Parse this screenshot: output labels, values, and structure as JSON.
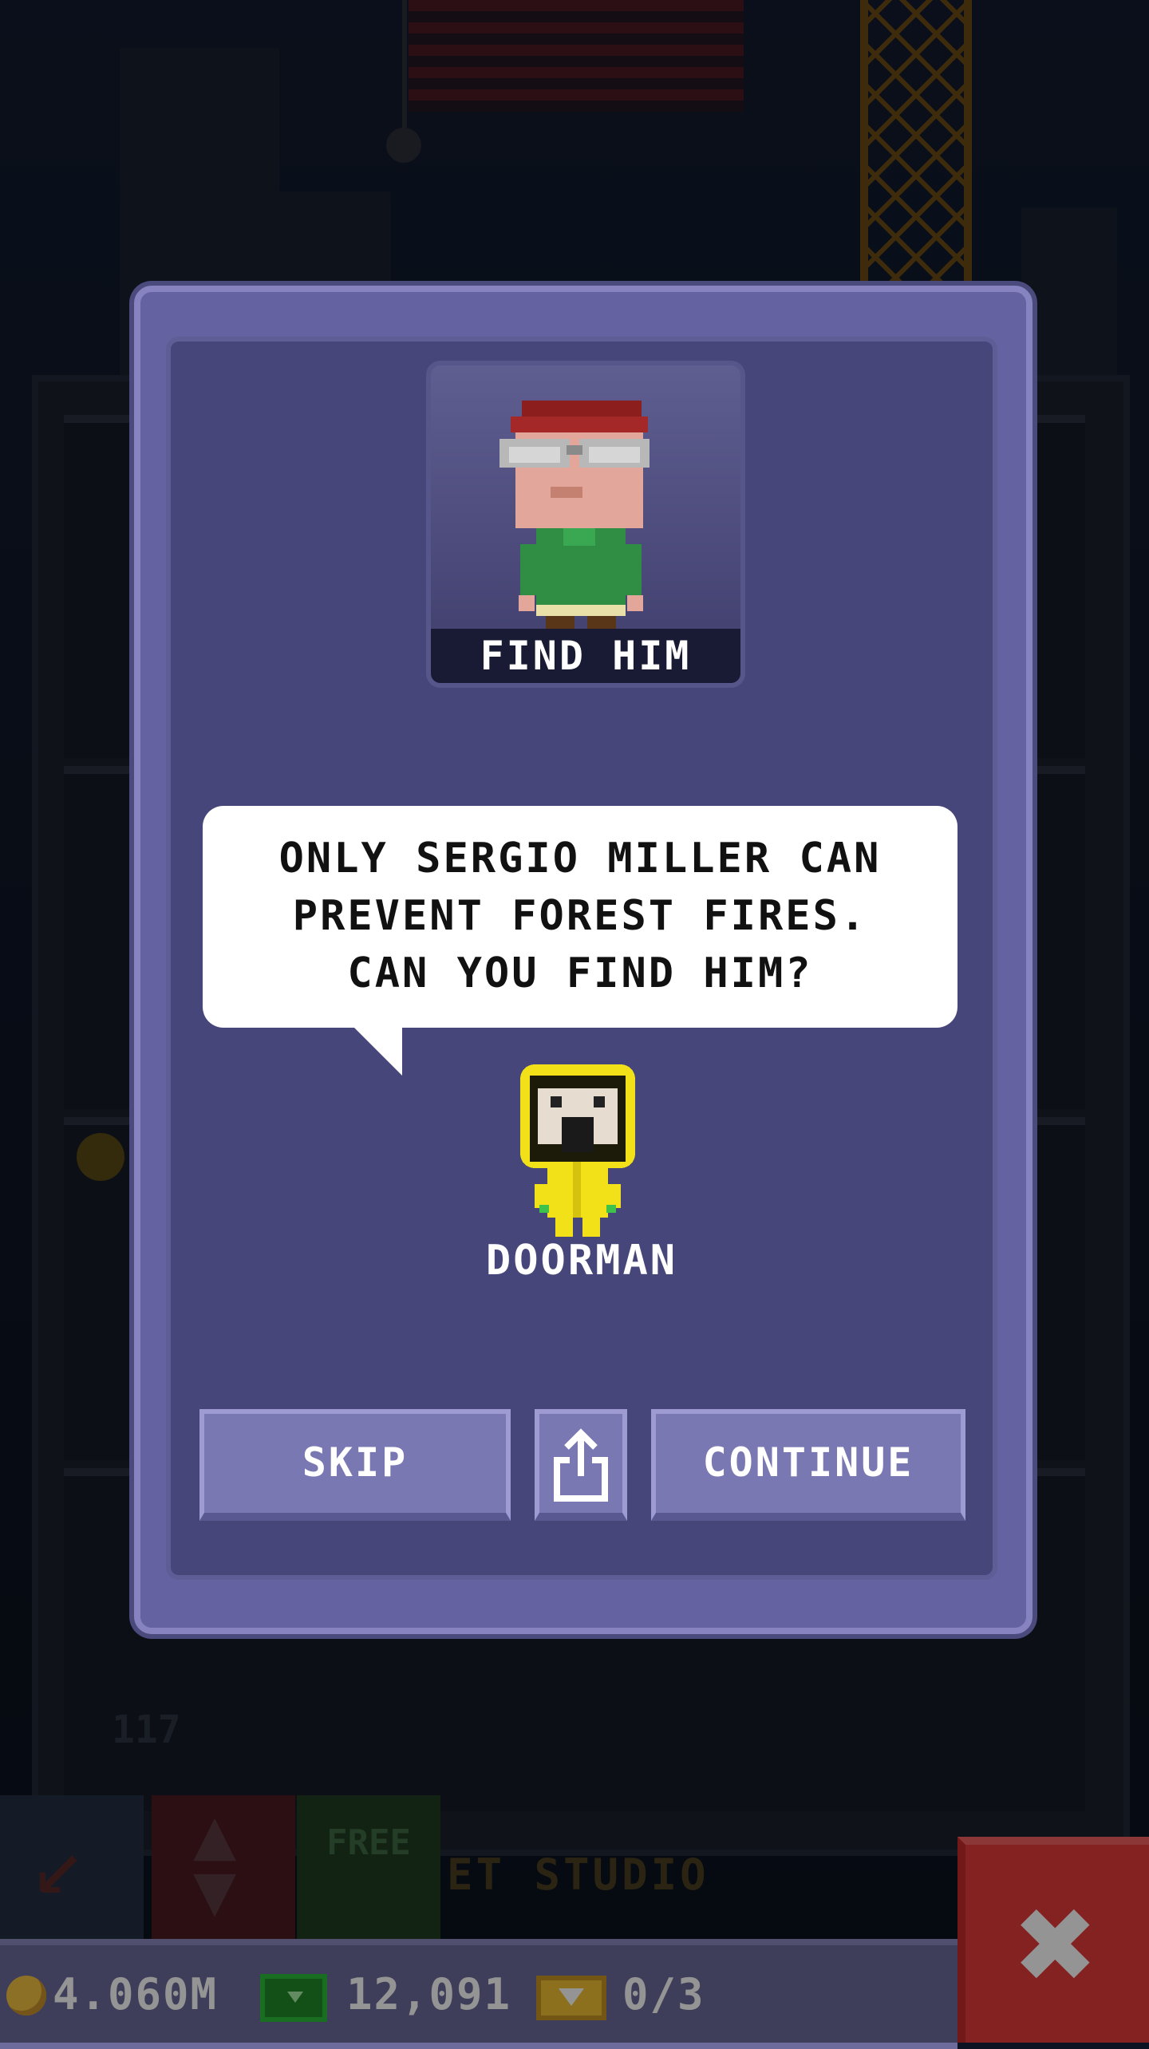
{
  "dialog": {
    "banner_label": "FIND HIM",
    "speech_text": "ONLY SERGIO MILLER CAN\nPREVENT FOREST FIRES.\nCAN YOU FIND HIM?",
    "speaker_name": "DOORMAN",
    "buttons": {
      "skip": "SKIP",
      "continue": "CONTINUE"
    }
  },
  "background": {
    "floor_number": "117",
    "studio_label": "ET STUDIO",
    "free_label": "FREE"
  },
  "status": {
    "coins": "4.060M",
    "bux": "12,091",
    "tickets": "0/3"
  },
  "colors": {
    "modal_bg": "#47467a",
    "modal_frame": "#6462a0",
    "button": "#7a78b2",
    "close_button": "#e33a3a",
    "doorman_raincoat": "#f2e118",
    "coin": "#f2c243",
    "bux": "#1f8a2a"
  },
  "icons": [
    "share-icon",
    "close-icon",
    "coin-icon",
    "bux-icon",
    "ticket-icon",
    "elevator-icon",
    "up-down-arrows-icon"
  ]
}
